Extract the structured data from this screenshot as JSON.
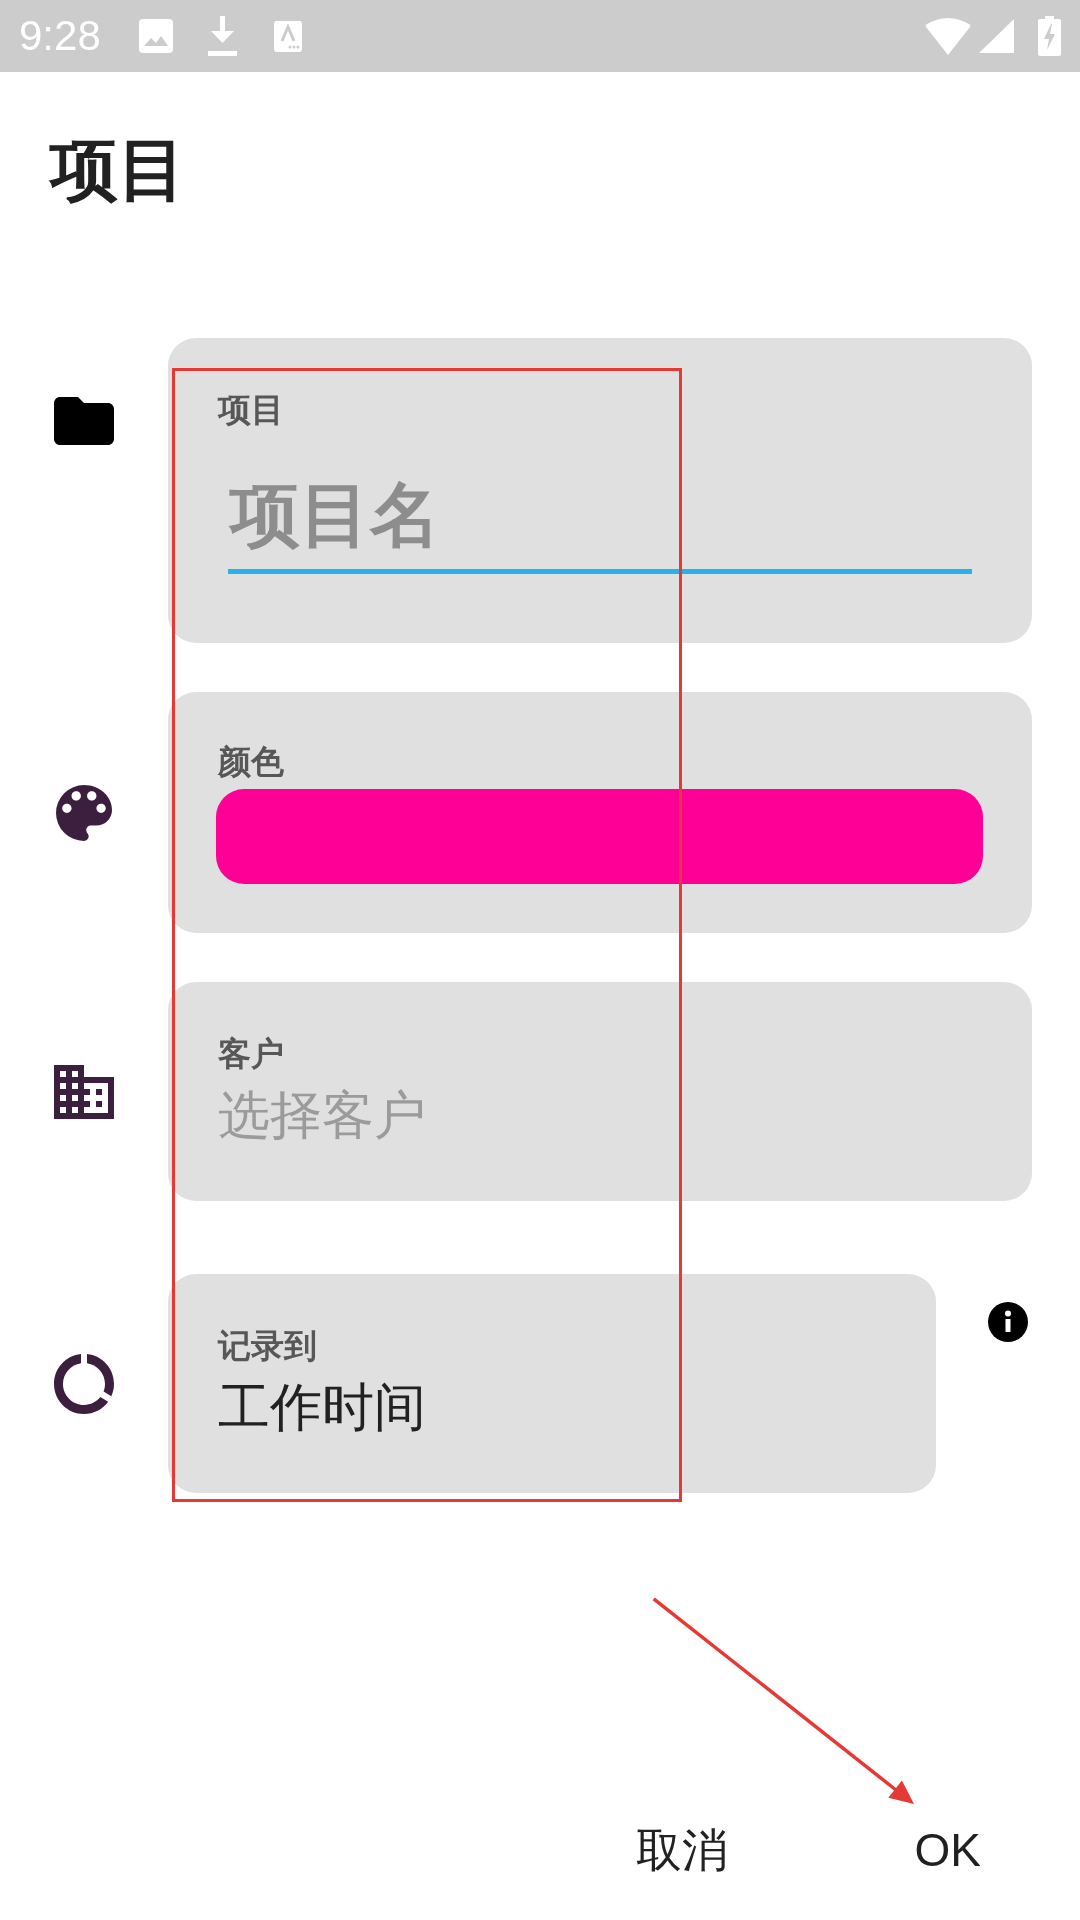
{
  "status_bar": {
    "time": "9:28"
  },
  "title": "项目",
  "fields": [
    {
      "kind": "text",
      "label": "项目",
      "placeholder": "项目名",
      "info": false
    },
    {
      "kind": "color",
      "label": "颜色",
      "color": "#ff0096",
      "info": false
    },
    {
      "kind": "picker",
      "label": "客户",
      "placeholder": "选择客户",
      "info": false
    },
    {
      "kind": "picker",
      "label": "记录到",
      "value": "工作时间",
      "info": true
    }
  ],
  "buttons": [
    {
      "label": "取消"
    },
    {
      "label": "OK"
    }
  ],
  "annotations": {
    "box": true,
    "arrow": true
  }
}
